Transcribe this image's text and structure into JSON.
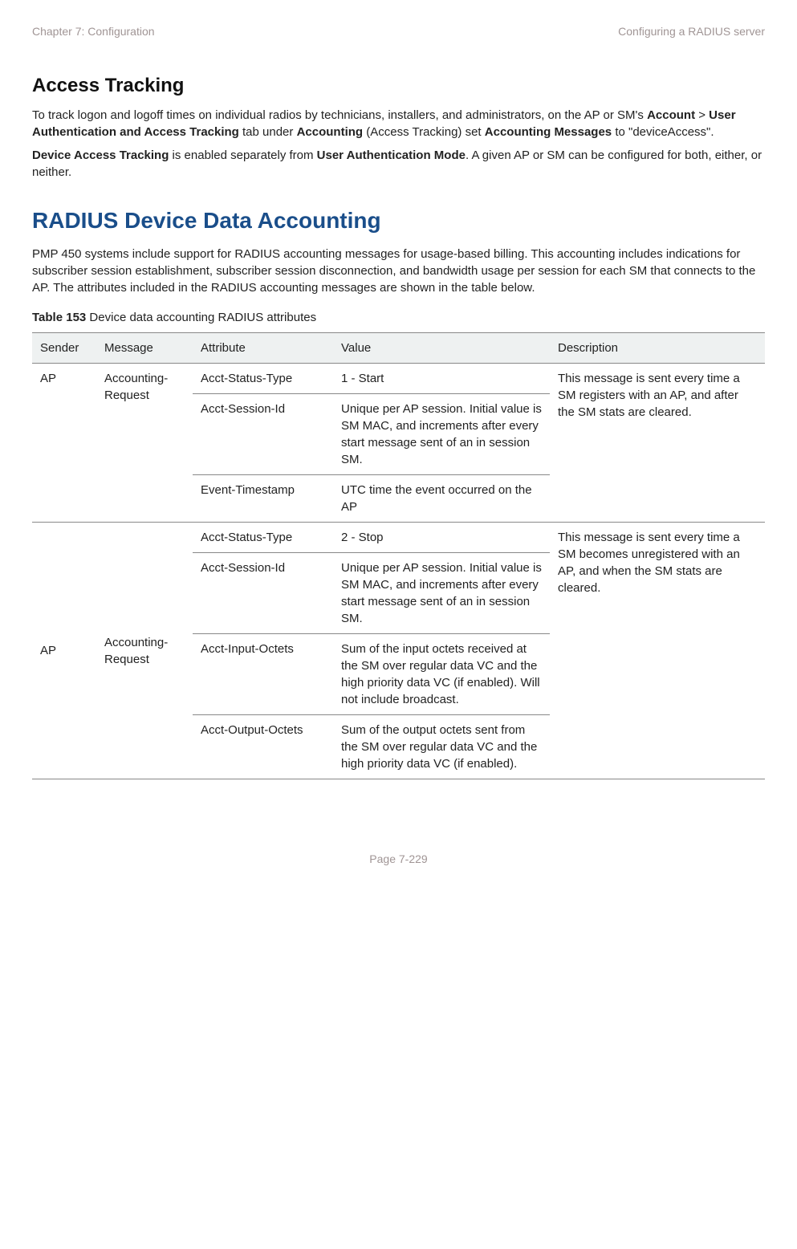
{
  "header": {
    "left": "Chapter 7:  Configuration",
    "right": "Configuring a RADIUS server"
  },
  "section1": {
    "title": "Access Tracking",
    "p1a": "To track logon and logoff times on individual radios by technicians, installers, and administrators, on the AP or SM's ",
    "p1b": "Account",
    "p1c": " > ",
    "p1d": "User Authentication and Access Tracking",
    "p1e": " tab under ",
    "p1f": "Accounting",
    "p1g": " (Access Tracking) set ",
    "p1h": "Accounting Messages",
    "p1i": " to \"deviceAccess\".",
    "p2a": "Device Access Tracking",
    "p2b": " is enabled separately from ",
    "p2c": "User Authentication Mode",
    "p2d": ". A given AP or SM can be configured for both, either, or neither."
  },
  "section2": {
    "title": "RADIUS Device Data Accounting",
    "p1": "PMP 450 systems include support for RADIUS accounting messages for usage-based billing. This accounting includes indications for subscriber session establishment, subscriber session disconnection, and bandwidth usage per session for each SM that connects to the AP. The attributes included in the RADIUS accounting messages are shown in the table below."
  },
  "table": {
    "caption_bold": "Table 153",
    "caption_rest": " Device data accounting RADIUS attributes",
    "headers": {
      "c1": "Sender",
      "c2": "Message",
      "c3": "Attribute",
      "c4": "Value",
      "c5": "Description"
    },
    "g1": {
      "sender": "AP",
      "message": "Accounting-Request",
      "desc": "This message is sent every time a SM registers with an AP, and after the SM stats are cleared.",
      "r1": {
        "attr": "Acct-Status-Type",
        "val": "1 - Start"
      },
      "r2": {
        "attr": "Acct-Session-Id",
        "val": "Unique per AP session. Initial value is SM MAC, and increments after every start message sent of an in session SM."
      },
      "r3": {
        "attr": "Event-Timestamp",
        "val": "UTC time the event occurred on the AP"
      }
    },
    "g2": {
      "sender": "AP",
      "message": "Accounting-Request",
      "desc": "This message is sent every time a SM becomes unregistered with an AP, and when the SM stats are cleared.",
      "r1": {
        "attr": "Acct-Status-Type",
        "val": "2 - Stop"
      },
      "r2": {
        "attr": "Acct-Session-Id",
        "val": "Unique per AP session. Initial value is SM MAC, and increments after every start message sent of an in session SM."
      },
      "r3": {
        "attr": "Acct-Input-Octets",
        "val": "Sum of the input octets received at the SM over regular data VC and the high priority data VC (if enabled). Will not include broadcast."
      },
      "r4": {
        "attr": "Acct-Output-Octets",
        "val": "Sum of the output octets sent from the SM over regular data VC and the high priority data VC (if enabled)."
      }
    }
  },
  "footer": "Page 7-229"
}
